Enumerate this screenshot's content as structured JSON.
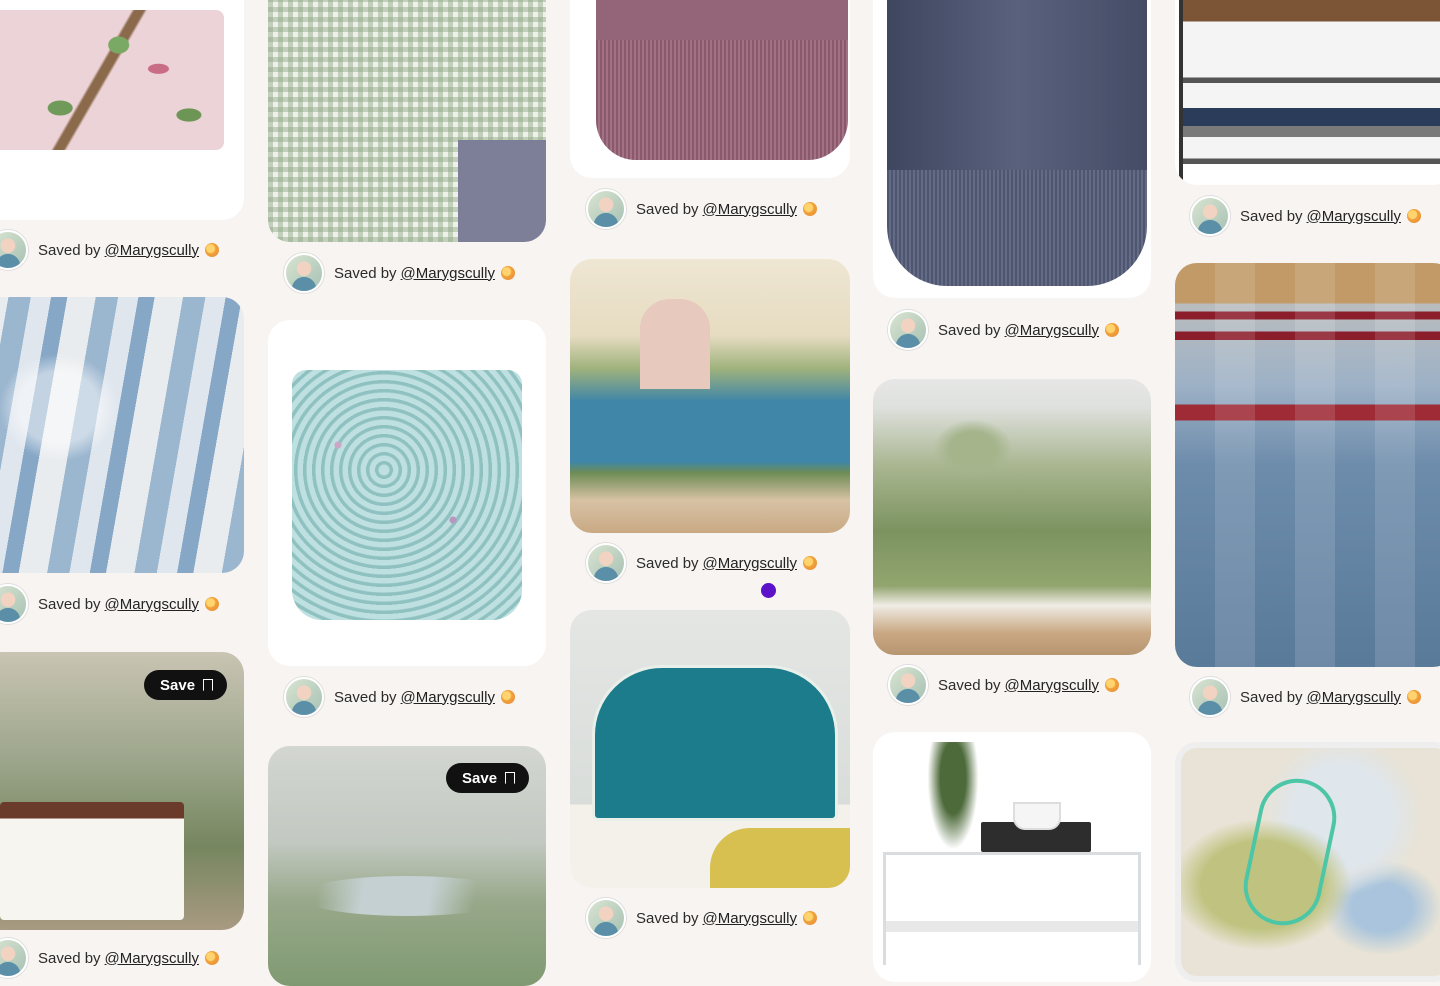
{
  "saved_by": {
    "prefix": "Saved by",
    "username": "@Marygscully",
    "badge_icon": "verified-badge-icon"
  },
  "save_button": {
    "label": "Save",
    "icon": "bookmark-icon"
  },
  "pins": [
    {
      "name": "pin-bird-pillow"
    },
    {
      "name": "pin-ikat-wallpaper"
    },
    {
      "name": "pin-palm-bedroom-mural"
    },
    {
      "name": "pin-gingham-sheets"
    },
    {
      "name": "pin-floral-slipper-chair"
    },
    {
      "name": "pin-marsh-landscape-mural"
    },
    {
      "name": "pin-mauve-fringe-ottoman"
    },
    {
      "name": "pin-indian-garden-mural"
    },
    {
      "name": "pin-teal-headboard"
    },
    {
      "name": "pin-navy-fringe-ottoman"
    },
    {
      "name": "pin-meadow-mural"
    },
    {
      "name": "pin-acrylic-side-table"
    },
    {
      "name": "pin-shoe-rack"
    },
    {
      "name": "pin-kilim-rug"
    },
    {
      "name": "pin-abstract-painting"
    }
  ],
  "colors": {
    "background": "#f8f4f2",
    "accent_cursor": "#5b12c9",
    "save_button_bg": "#111111"
  }
}
